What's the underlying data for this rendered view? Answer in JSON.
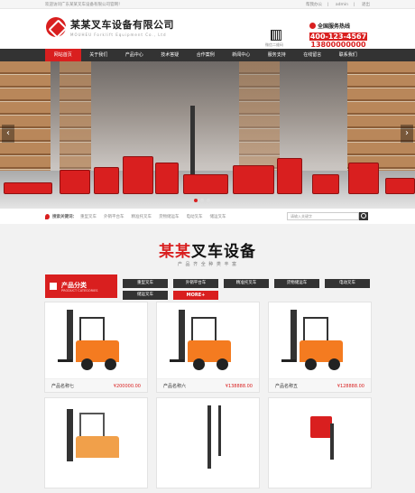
{
  "topbar": {
    "welcome": "欢迎访问广东某某叉车设备有限公司官网！",
    "link_favorite": "帮我办公",
    "link_admin": "admin",
    "link_logout": "退出"
  },
  "header": {
    "company_name": "某某叉车设备有限公司",
    "company_en": "MOUHEU Forklift Equipment Co., Ltd",
    "qr_label": "微信二维码",
    "hotline_title": "全国服务热线",
    "phone_1": "400-123-4567",
    "phone_2": "13800000000"
  },
  "nav": [
    "网站首页",
    "关于我们",
    "产品中心",
    "技术答疑",
    "合作案例",
    "新闻中心",
    "服务支持",
    "在线留言",
    "联系我们"
  ],
  "search": {
    "hot_title": "搜索关键词：",
    "keywords": [
      "重型叉车",
      "外销平台车",
      "精准托叉车",
      "货物储运车",
      "电动叉车",
      "储运叉车"
    ],
    "placeholder": "请输入关键字"
  },
  "products_section": {
    "title_red": "某某",
    "title_black": "叉车设备",
    "subtitle": "产 品 齐 全   种 类 丰 富",
    "category_cn": "产品分类",
    "category_en": "PRODUCT CATEGORIES",
    "tabs": [
      "重型叉车",
      "外销平台车",
      "精准托叉车",
      "货物储运车",
      "电动叉车",
      "储运叉车"
    ],
    "more_label": "MORE+"
  },
  "products": [
    {
      "name": "产品名称七",
      "price": "¥200000.00"
    },
    {
      "name": "产品名称六",
      "price": "¥138888.00"
    },
    {
      "name": "产品名称五",
      "price": "¥128888.00"
    },
    {
      "name": "",
      "price": ""
    },
    {
      "name": "",
      "price": ""
    },
    {
      "name": "",
      "price": ""
    }
  ],
  "colors": {
    "brand_red": "#d91f1f",
    "nav_dark": "#333333",
    "forklift_orange": "#f47b20"
  },
  "banner": {
    "prev_label": "‹",
    "next_label": "›"
  }
}
